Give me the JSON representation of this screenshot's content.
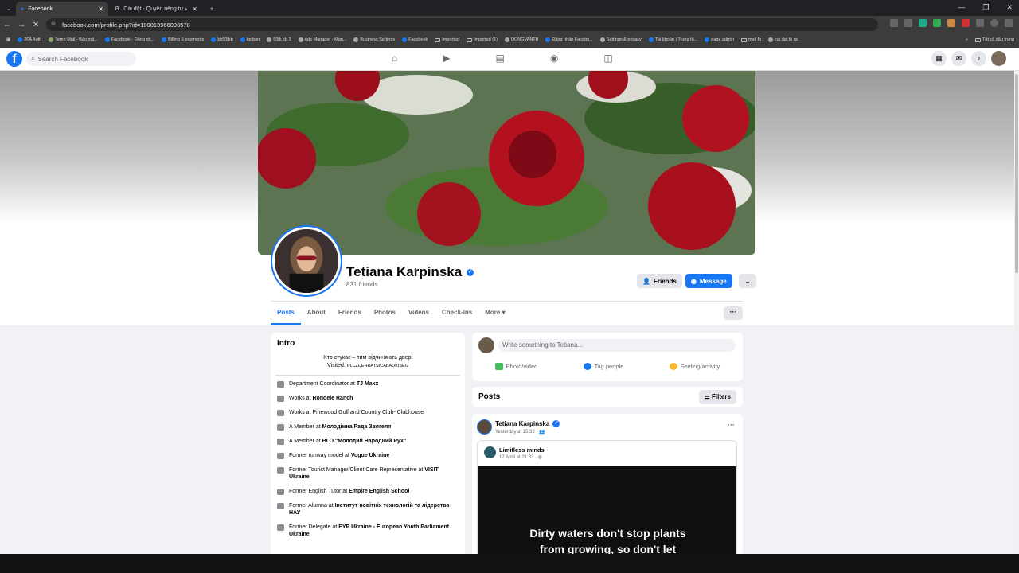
{
  "browser": {
    "tabs": [
      {
        "label": "Facebook"
      },
      {
        "label": "Cài đặt - Quyền riêng tư và bảo"
      }
    ],
    "url": "facebook.com/profile.php?id=100013966093578",
    "bookmarks": [
      "2FA Auth",
      "Temp Mail - Bảo mậ...",
      "Facebook - Đăng nh...",
      "Billing & payments",
      "kb50tkb",
      "ketban",
      "50tk kb 3",
      "Ads Manager - Man...",
      "Business Settings",
      "Facebook",
      "Imported",
      "Imported (1)",
      "DONGVANFB",
      "Đăng nhập Facebo...",
      "Settings & privacy",
      "Tài khoản | Trung tâ...",
      "page admin",
      "mail fb",
      "cai dat tk qc"
    ],
    "all_bookmarks": "Tất cả dấu trang"
  },
  "fb": {
    "search_placeholder": "Search Facebook"
  },
  "profile": {
    "name": "Tetiana Karpinska",
    "friends_count": "831 friends",
    "btn_friends": "Friends",
    "btn_message": "Message",
    "tabs": [
      "Posts",
      "About",
      "Friends",
      "Photos",
      "Videos",
      "Check-ins",
      "More"
    ]
  },
  "intro": {
    "title": "Intro",
    "bio_line1": "Хто стукає – тим відчиняють двері",
    "bio_line2_prefix": "Visited:",
    "bio_line2_code": "PLCZDEHRATSICABADKISEG",
    "items": [
      {
        "pre": "Department Coordinator at ",
        "b": "TJ Maxx"
      },
      {
        "pre": "Works at ",
        "b": "Rondele Ranch"
      },
      {
        "pre": "Works at Pinewood Golf and Country Club- Clubhouse",
        "b": ""
      },
      {
        "pre": "A Member at ",
        "b": "Молодіжна Рада Звягеля"
      },
      {
        "pre": "A Member at ",
        "b": "ВГО \"Молодий Народний Рух\""
      },
      {
        "pre": "Former runway model at ",
        "b": "Vogue Ukraine"
      },
      {
        "pre": "Former Tourist Manager/Client Care Representative at ",
        "b": "VISIT Ukraine"
      },
      {
        "pre": "Former English Tutor at ",
        "b": "Empire English School"
      },
      {
        "pre": "Former Alumna at ",
        "b": "Інститут новітніх технологій та лідерства НАУ"
      },
      {
        "pre": "Former Delegate at ",
        "b": "EYP Ukraine - European Youth Parliament Ukraine"
      }
    ]
  },
  "composer": {
    "placeholder": "Write something to Tetiana...",
    "actions": [
      "Photo/video",
      "Tag people",
      "Feeling/activity"
    ]
  },
  "posts": {
    "title": "Posts",
    "filters": "Filters",
    "author": "Tetiana Karpinska",
    "time": "Yesterday at 15:32 ·",
    "shared_author": "Limitless minds",
    "shared_time": "17 April at 21:33 ·",
    "image_text_1": "Dirty waters don't stop plants",
    "image_text_2": "from growing, so don't let"
  }
}
